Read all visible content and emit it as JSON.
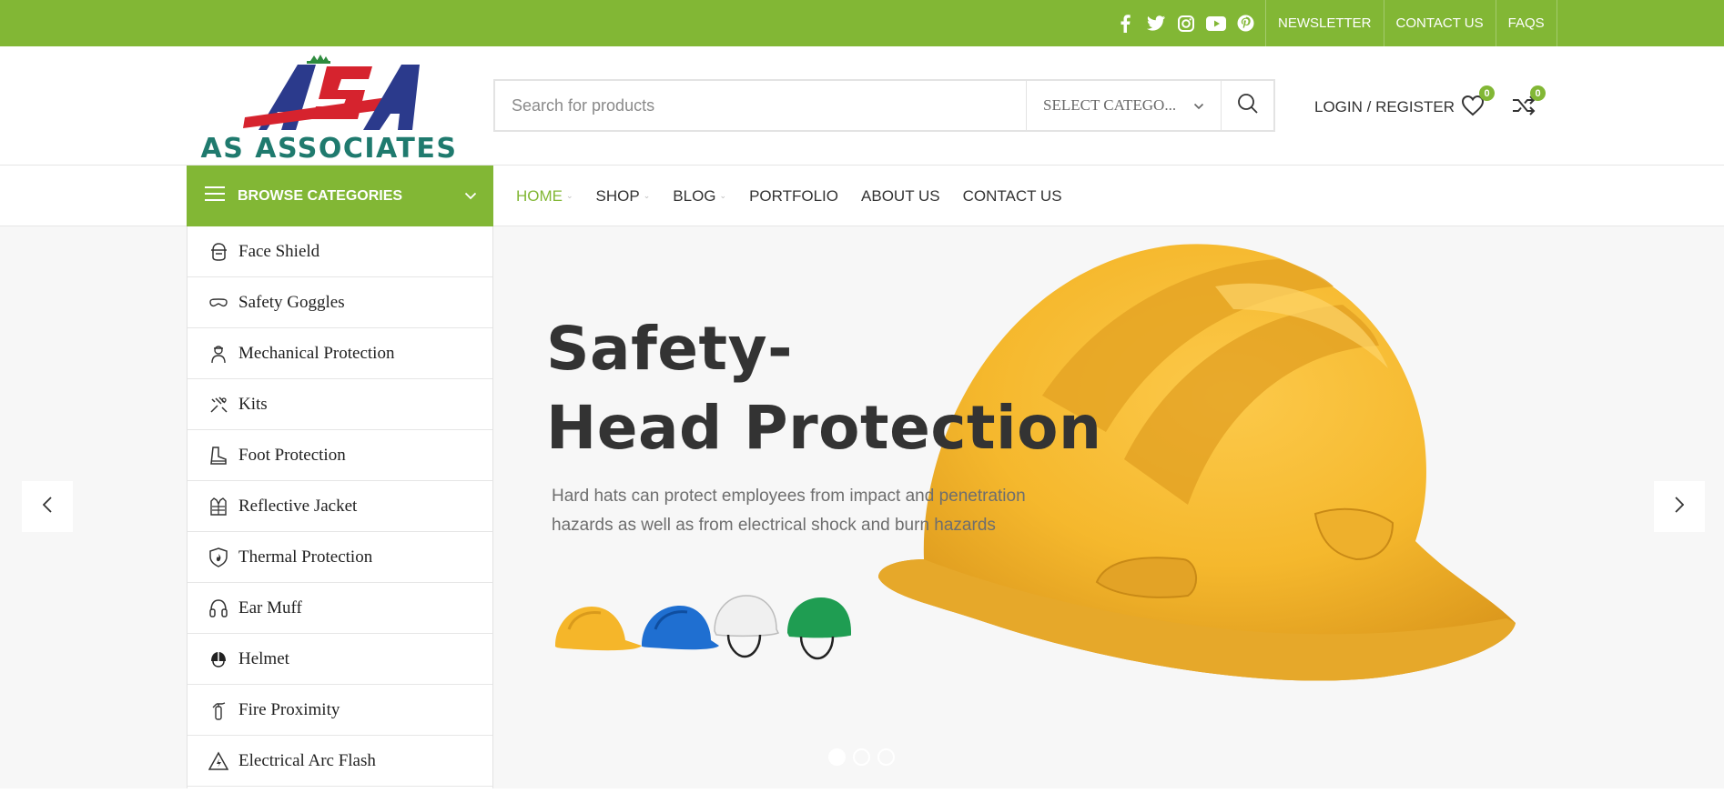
{
  "brand": {
    "accent": "#82b735",
    "logo_letters": "ASA",
    "logo_name": "AS ASSOCIATES"
  },
  "topbar": {
    "social": [
      "facebook-icon",
      "twitter-icon",
      "instagram-icon",
      "youtube-icon",
      "pinterest-icon"
    ],
    "links": [
      "NEWSLETTER",
      "CONTACT US",
      "FAQS"
    ]
  },
  "header": {
    "search_placeholder": "Search for products",
    "category_select": "SELECT CATEGO...",
    "login": "LOGIN / REGISTER",
    "wishlist_count": "0",
    "compare_count": "0"
  },
  "nav": {
    "browse_label": "BROWSE CATEGORIES",
    "menu": [
      {
        "label": "HOME",
        "dropdown": true,
        "active": true
      },
      {
        "label": "SHOP",
        "dropdown": true,
        "active": false
      },
      {
        "label": "BLOG",
        "dropdown": true,
        "active": false
      },
      {
        "label": "PORTFOLIO",
        "dropdown": false,
        "active": false
      },
      {
        "label": "ABOUT US",
        "dropdown": false,
        "active": false
      },
      {
        "label": "CONTACT US",
        "dropdown": false,
        "active": false
      }
    ]
  },
  "categories": [
    {
      "label": "Face Shield",
      "icon": "face-shield-icon"
    },
    {
      "label": "Safety Goggles",
      "icon": "goggles-icon"
    },
    {
      "label": "Mechanical Protection",
      "icon": "worker-icon"
    },
    {
      "label": "Kits",
      "icon": "kit-icon"
    },
    {
      "label": "Foot Protection",
      "icon": "boot-icon"
    },
    {
      "label": "Reflective Jacket",
      "icon": "jacket-icon"
    },
    {
      "label": "Thermal Protection",
      "icon": "fire-shield-icon"
    },
    {
      "label": "Ear Muff",
      "icon": "ear-muff-icon"
    },
    {
      "label": "Helmet",
      "icon": "helmet-icon"
    },
    {
      "label": "Fire Proximity",
      "icon": "extinguisher-icon"
    },
    {
      "label": "Electrical Arc Flash",
      "icon": "arc-flash-icon"
    }
  ],
  "hero": {
    "title_line1": "Safety-",
    "title_line2": "Head Protection",
    "description": "Hard hats can protect employees from impact and penetration hazards as well as from electrical shock and burn hazards",
    "slides": 3,
    "active_slide": 1
  }
}
